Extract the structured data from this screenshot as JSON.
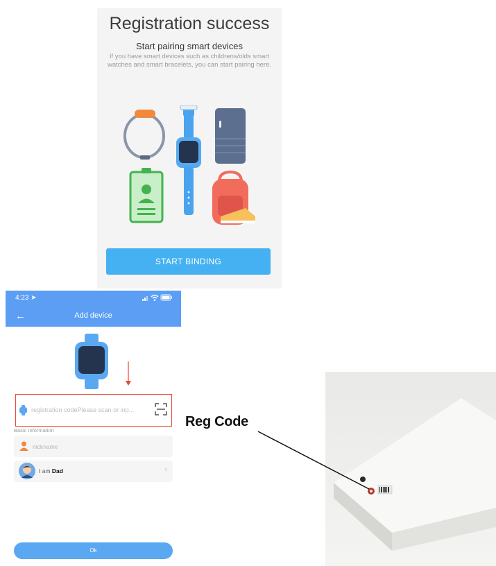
{
  "registration": {
    "title": "Registration success",
    "subtitle": "Start pairing smart devices",
    "description": "If you have smart devices such as childrens/olds smart watches and smart bracelets, you can start pairing here.",
    "button_label": "START BINDING",
    "device_icons": [
      "bracelet-icon",
      "smartwatch-icon",
      "tracker-icon",
      "id-card-icon",
      "backpack-icon"
    ]
  },
  "phone": {
    "status_bar": {
      "time": "4:23",
      "icons": [
        "location-icon",
        "signal-icon",
        "wifi-icon",
        "battery-icon"
      ]
    },
    "nav": {
      "title": "Add device",
      "back_icon": "back-arrow-icon"
    },
    "reg_field": {
      "placeholder": "registration codePlease scan or inp...",
      "value": ""
    },
    "basic_info_label": "Basic Information",
    "nickname": {
      "placeholder": "nickname",
      "value": ""
    },
    "relation": {
      "prefix": "I am",
      "value": "Dad"
    },
    "ok_label": "Ok"
  },
  "annotation": {
    "label": "Reg Code"
  },
  "colors": {
    "primary_blue": "#5b9ef3",
    "button_blue": "#45b1f3",
    "highlight_red": "#e34a3a"
  }
}
